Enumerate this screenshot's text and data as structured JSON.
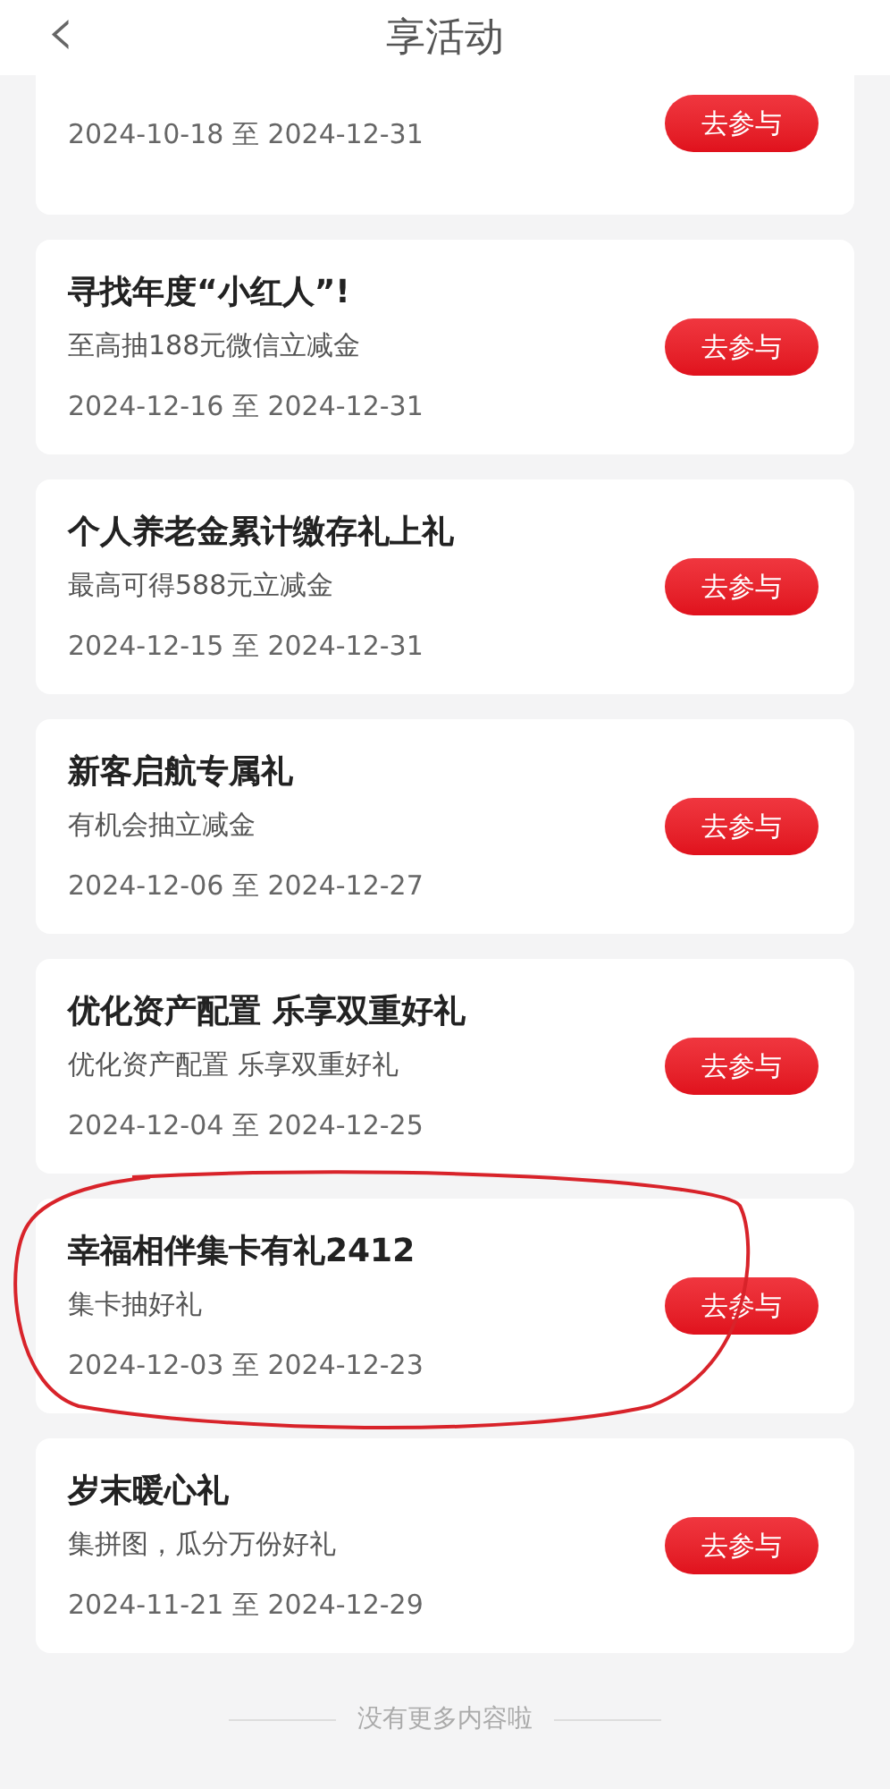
{
  "header": {
    "back_icon": "‹",
    "title": "享活动"
  },
  "activities": [
    {
      "date": "2024-10-18 至 2024-12-31",
      "button": "去参与",
      "circled": false
    },
    {
      "title": "寻找年度“小红人”!",
      "subtitle": "至高抽188元微信立减金",
      "date": "2024-12-16 至 2024-12-31",
      "button": "去参与",
      "circled": false
    },
    {
      "title": "个人养老金累计缴存礼上礼",
      "subtitle": "最高可得588元立减金",
      "date": "2024-12-15 至 2024-12-31",
      "button": "去参与",
      "circled": false
    },
    {
      "title": "新客启航专属礼",
      "subtitle": "有机会抽立减金",
      "date": "2024-12-06 至 2024-12-27",
      "button": "去参与",
      "circled": false
    },
    {
      "title": "优化资产配置 乐享双重好礼",
      "subtitle": "优化资产配置 乐享双重好礼",
      "date": "2024-12-04 至 2024-12-25",
      "button": "去参与",
      "circled": false
    },
    {
      "title": "幸福相伴集卡有礼2412",
      "subtitle": "集卡抽好礼",
      "date": "2024-12-03 至 2024-12-23",
      "button": "去参与",
      "circled": true
    },
    {
      "title": "岁末暖心礼",
      "subtitle": "集拼图，瓜分万份好礼",
      "date": "2024-11-21 至 2024-12-29",
      "button": "去参与",
      "circled": false
    }
  ],
  "footer": "没有更多内容啦"
}
